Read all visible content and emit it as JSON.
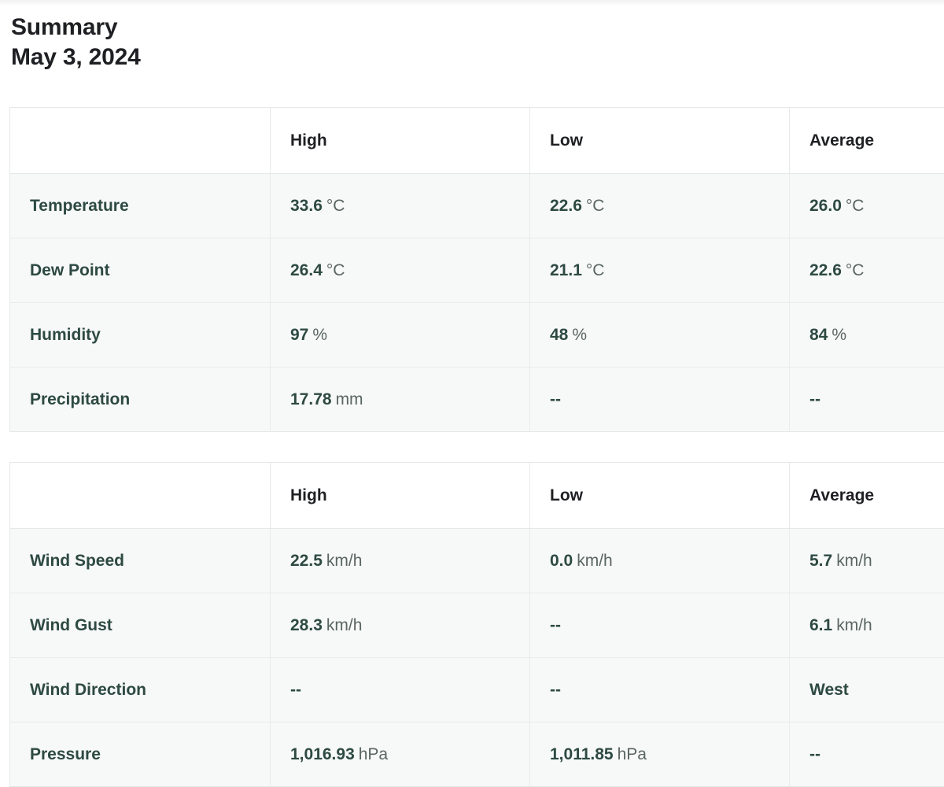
{
  "header": {
    "title": "Summary",
    "date": "May 3, 2024"
  },
  "placeholder": "--",
  "tables": [
    {
      "name": "conditions-table",
      "columns": [
        "",
        "High",
        "Low",
        "Average"
      ],
      "rows": [
        {
          "label": "Temperature",
          "high_value": "33.6",
          "high_unit": "°C",
          "low_value": "22.6",
          "low_unit": "°C",
          "avg_value": "26.0",
          "avg_unit": "°C"
        },
        {
          "label": "Dew Point",
          "high_value": "26.4",
          "high_unit": "°C",
          "low_value": "21.1",
          "low_unit": "°C",
          "avg_value": "22.6",
          "avg_unit": "°C"
        },
        {
          "label": "Humidity",
          "high_value": "97",
          "high_unit": "%",
          "low_value": "48",
          "low_unit": "%",
          "avg_value": "84",
          "avg_unit": "%"
        },
        {
          "label": "Precipitation",
          "high_value": "17.78",
          "high_unit": "mm",
          "low_value": "--",
          "low_unit": "",
          "avg_value": "--",
          "avg_unit": ""
        }
      ]
    },
    {
      "name": "wind-pressure-table",
      "columns": [
        "",
        "High",
        "Low",
        "Average"
      ],
      "rows": [
        {
          "label": "Wind Speed",
          "high_value": "22.5",
          "high_unit": "km/h",
          "low_value": "0.0",
          "low_unit": "km/h",
          "avg_value": "5.7",
          "avg_unit": "km/h"
        },
        {
          "label": "Wind Gust",
          "high_value": "28.3",
          "high_unit": "km/h",
          "low_value": "--",
          "low_unit": "",
          "avg_value": "6.1",
          "avg_unit": "km/h"
        },
        {
          "label": "Wind Direction",
          "high_value": "--",
          "high_unit": "",
          "low_value": "--",
          "low_unit": "",
          "avg_value": "West",
          "avg_unit": ""
        },
        {
          "label": "Pressure",
          "high_value": "1,016.93",
          "high_unit": "hPa",
          "low_value": "1,011.85",
          "low_unit": "hPa",
          "avg_value": "--",
          "avg_unit": ""
        }
      ]
    }
  ],
  "colors": {
    "data_text": "#2d4a42",
    "unit_text": "#5a6660",
    "header_text": "#1f2023",
    "row_background": "#f7f8f8",
    "border": "#e6e8e7"
  }
}
